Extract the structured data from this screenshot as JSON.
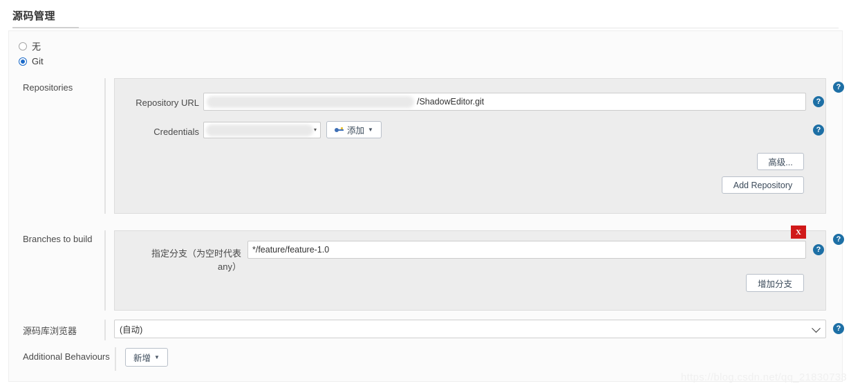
{
  "page": {
    "title": "源码管理",
    "watermark": "https://blog.csdn.net/qq_21830733"
  },
  "scm_type": {
    "options": [
      {
        "label": "无",
        "selected": false
      },
      {
        "label": "Git",
        "selected": true
      }
    ]
  },
  "repositories": {
    "label": "Repositories",
    "repository_url": {
      "label": "Repository URL",
      "value": "/ShadowEditor.git",
      "redacted": true
    },
    "credentials": {
      "label": "Credentials",
      "value": "",
      "redacted": true,
      "add_button": "添加"
    },
    "advanced_button": "高级...",
    "add_repository_button": "Add Repository"
  },
  "branches": {
    "label": "Branches to build",
    "branch_specifier": {
      "label": "指定分支（为空时代表any）",
      "value": "*/feature/feature-1.0"
    },
    "delete_button": "X",
    "add_branch_button": "增加分支"
  },
  "repository_browser": {
    "label": "源码库浏览器",
    "value": "(自动)"
  },
  "additional_behaviours": {
    "label": "Additional Behaviours",
    "add_button": "新增"
  },
  "help": {
    "glyph": "?"
  },
  "colors": {
    "accent_blue": "#1b6ac9",
    "help_blue": "#1d6fa5",
    "delete_red": "#d01919",
    "panel_gray": "#ededed"
  }
}
